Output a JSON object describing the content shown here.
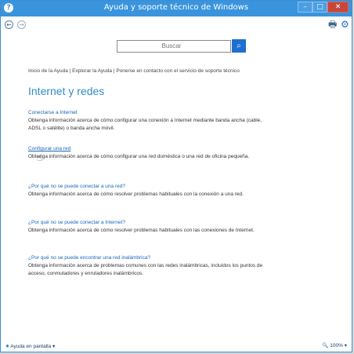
{
  "window": {
    "title": "Ayuda y soporte técnico de Windows",
    "app_icon": "?",
    "controls": {
      "minimize": "–",
      "maximize": "□",
      "close": "✕"
    }
  },
  "toolbar": {
    "back_icon": "←",
    "forward_icon": "→",
    "print_icon": "🖶",
    "options_icon": "⚙"
  },
  "search": {
    "placeholder": "Buscar",
    "button_icon": "⌕"
  },
  "breadcrumb": {
    "items": [
      "Inicio de la Ayuda",
      "Explorar la Ayuda",
      "Ponerse en contacto con el servicio de soporte técnico"
    ],
    "separator": " | "
  },
  "page_title": "Internet y redes",
  "topics": [
    {
      "title": "Conectarse a Internet",
      "description": "Obtenga información acerca de cómo configurar una conexión a Internet mediante banda ancha (cable, ADSL o satélite) o banda ancha móvil."
    },
    {
      "title": "Configurar una red",
      "description": "Obtenga información acerca de cómo configurar una red doméstica o una red de oficina pequeña."
    },
    {
      "title": "¿Por qué no se puede conectar a una red?",
      "description": "Obtenga información acerca de cómo resolver problemas habituales con la conexión a una red."
    },
    {
      "title": "¿Por qué no se puede conectar a Internet?",
      "description": "Obtenga información acerca de cómo resolver problemas habituales con las conexiones de Internet."
    },
    {
      "title": "¿Por qué no se puede encontrar una red inalámbrica?",
      "description": "Obtenga información acerca de problemas comunes con las redes inalámbricas, incluidos los puntos de acceso, conmutadores y enrutadores inalámbricos."
    }
  ],
  "status": {
    "help_mode": "Ayuda en pantalla",
    "help_mode_arrow": "▾",
    "zoom": "100%",
    "zoom_arrow": "▾",
    "zoom_icon": "🔍"
  }
}
